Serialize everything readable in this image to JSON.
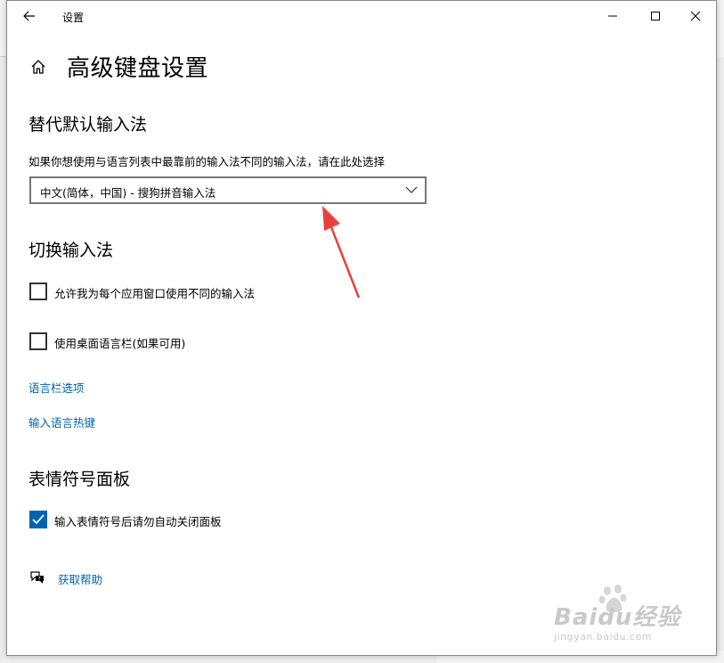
{
  "window": {
    "title": "设置"
  },
  "page": {
    "title": "高级键盘设置"
  },
  "section_override": {
    "title": "替代默认输入法",
    "description": "如果你想使用与语言列表中最靠前的输入法不同的输入法，请在此处选择",
    "selected_input_method": "中文(简体，中国) - 搜狗拼音输入法"
  },
  "section_switch": {
    "title": "切换输入法",
    "options": [
      {
        "label": "允许我为每个应用窗口使用不同的输入法",
        "checked": false
      },
      {
        "label": "使用桌面语言栏(如果可用)",
        "checked": false
      }
    ],
    "links": [
      "语言栏选项",
      "输入语言热键"
    ]
  },
  "section_emoji": {
    "title": "表情符号面板",
    "options": [
      {
        "label": "输入表情符号后请勿自动关闭面板",
        "checked": true
      }
    ]
  },
  "help": {
    "label": "获取帮助"
  },
  "watermark": {
    "brand": "Baidu经验",
    "url": "jingyan.baidu.com"
  },
  "colors": {
    "accent": "#0063b1",
    "annotation_arrow": "#e8413c"
  }
}
